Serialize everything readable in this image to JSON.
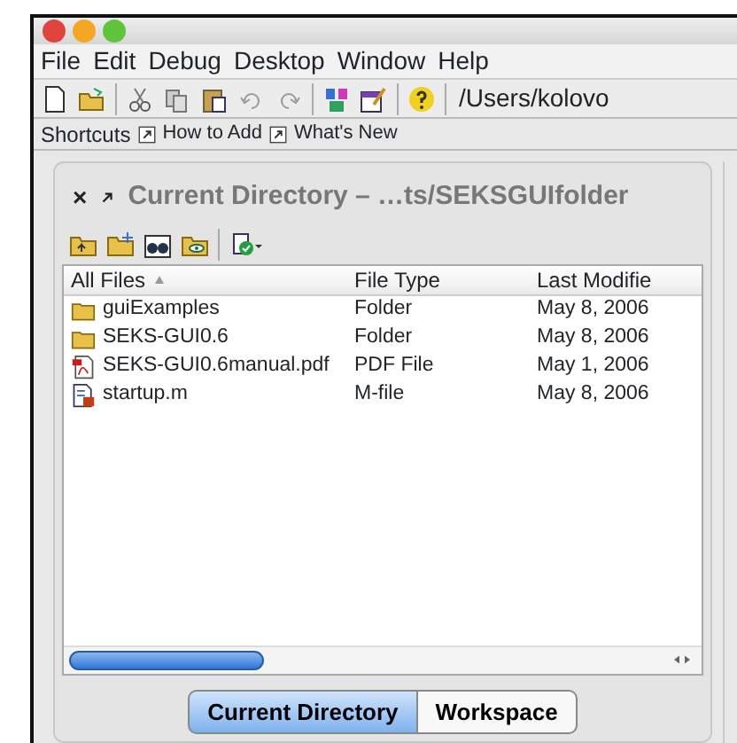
{
  "window": {
    "traffic_lights": [
      {
        "color": "#e0443e"
      },
      {
        "color": "#f5a623"
      },
      {
        "color": "#5fc43b"
      }
    ]
  },
  "menu": [
    "File",
    "Edit",
    "Debug",
    "Desktop",
    "Window",
    "Help"
  ],
  "toolbar": {
    "path": "/Users/kolovo"
  },
  "shortcuts": {
    "label": "Shortcuts",
    "items": [
      "How to Add",
      "What's New"
    ]
  },
  "panel": {
    "close": "×",
    "title": "Current Directory – …ts/SEKSGUIfolder",
    "table": {
      "columns": [
        {
          "label": "All Files",
          "sorted": true
        },
        {
          "label": "File Type",
          "sorted": false
        },
        {
          "label": "Last Modifie",
          "sorted": false
        }
      ],
      "rows": [
        {
          "kind": "folder",
          "name": "guiExamples",
          "type": "Folder",
          "modified": "May 8, 2006"
        },
        {
          "kind": "folder",
          "name": "SEKS-GUI0.6",
          "type": "Folder",
          "modified": "May 8, 2006"
        },
        {
          "kind": "pdf",
          "name": "SEKS-GUI0.6manual.pdf",
          "type": "PDF File",
          "modified": "May 1, 2006"
        },
        {
          "kind": "mfile",
          "name": "startup.m",
          "type": "M-file",
          "modified": "May 8, 2006"
        }
      ]
    }
  },
  "tabs": [
    {
      "label": "Current Directory",
      "selected": true
    },
    {
      "label": "Workspace",
      "selected": false
    }
  ]
}
